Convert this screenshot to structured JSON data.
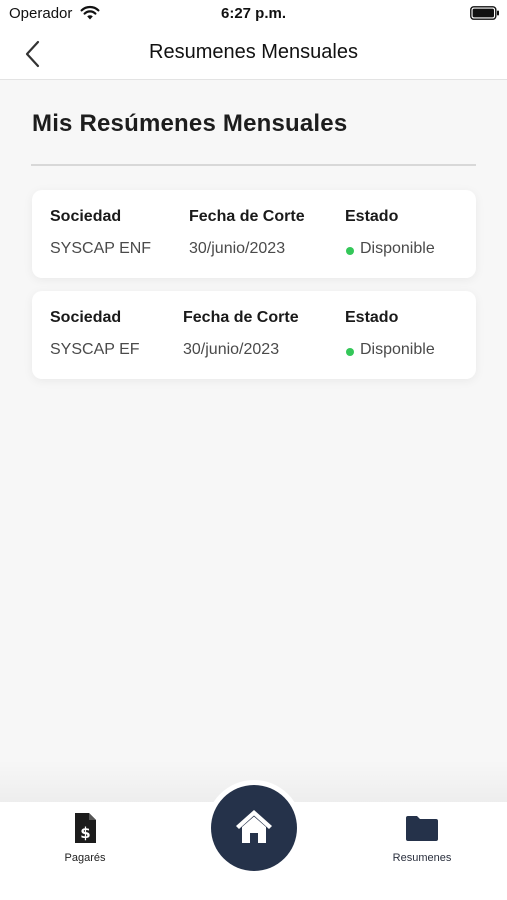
{
  "status_bar": {
    "carrier": "Operador",
    "time": "6:27 p.m.",
    "icons": [
      "wifi-icon",
      "battery-icon"
    ]
  },
  "nav": {
    "title": "Resumenes Mensuales",
    "back_icon": "chevron-left-icon"
  },
  "page": {
    "heading": "Mis Resúmenes Mensuales"
  },
  "summaries": [
    {
      "labels": {
        "company": "Sociedad",
        "cutoff": "Fecha de Corte",
        "status": "Estado"
      },
      "company": "SYSCAP ENF",
      "cutoff_date": "30/junio/2023",
      "status": "Disponible"
    },
    {
      "labels": {
        "company": "Sociedad",
        "cutoff": "Fecha de Corte",
        "status": "Estado"
      },
      "company": "SYSCAP EF",
      "cutoff_date": "30/junio/2023",
      "status": "Disponible"
    }
  ],
  "colors": {
    "status_available": "#34c759",
    "primary_dark": "#25324a"
  },
  "tab_bar": {
    "items": [
      {
        "label": "Pagarés",
        "icon": "document-dollar-icon"
      },
      {
        "label": "Resumenes",
        "icon": "folder-icon"
      }
    ],
    "center_icon": "home-icon"
  }
}
